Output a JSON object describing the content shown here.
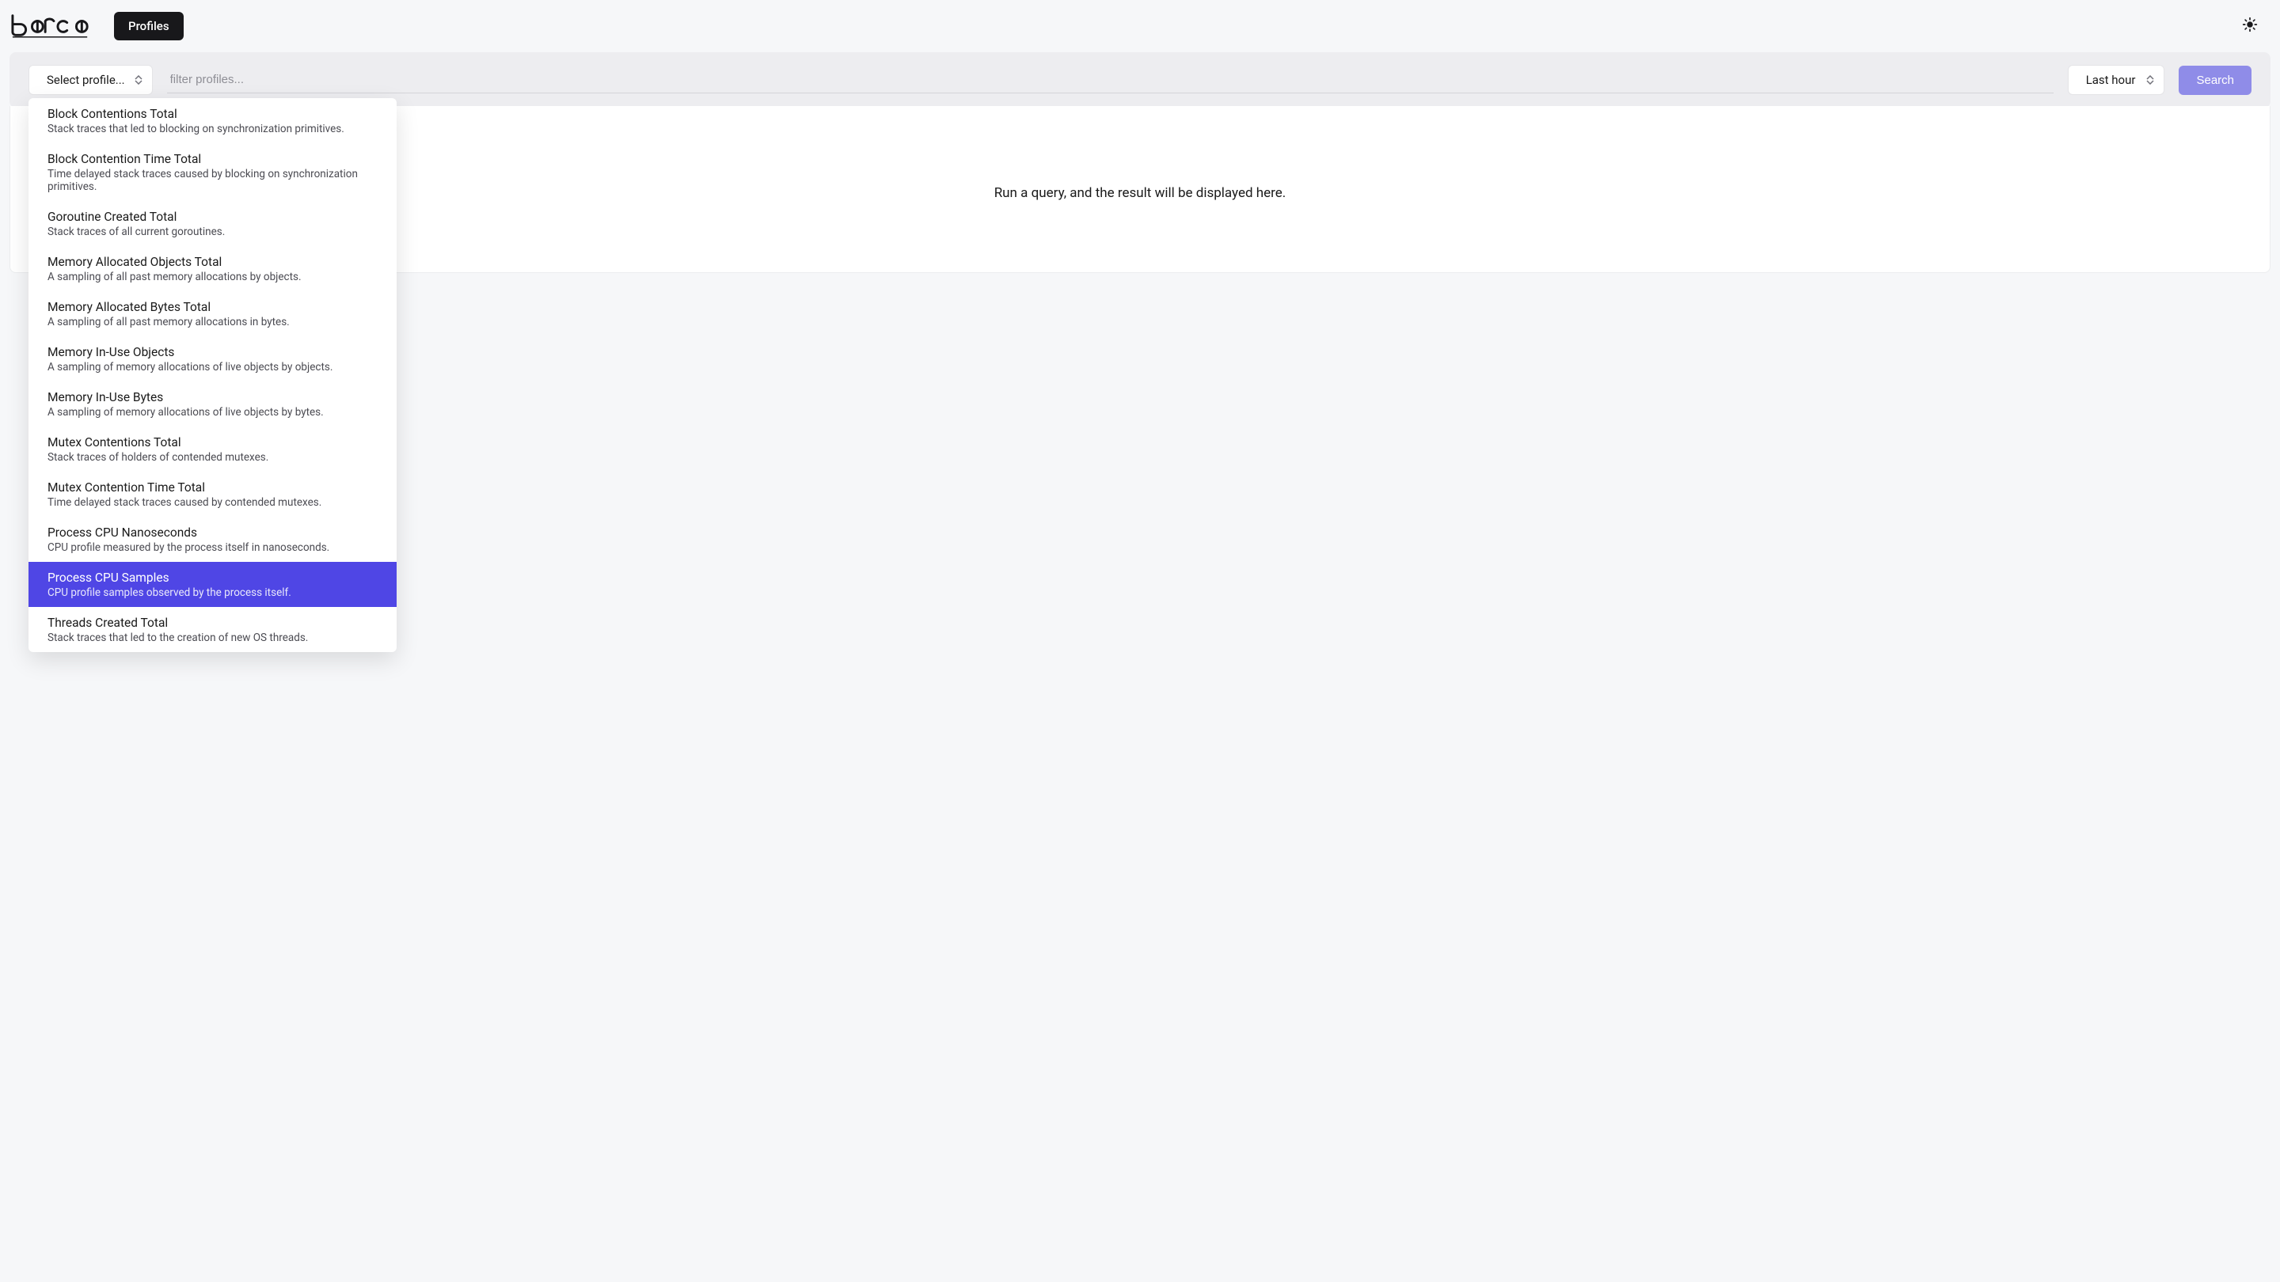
{
  "nav": {
    "profiles_label": "Profiles"
  },
  "query": {
    "select_profile_label": "Select profile...",
    "filter_placeholder": "filter profiles...",
    "time_range_label": "Last hour",
    "search_label": "Search"
  },
  "result": {
    "empty_message": "Run a query, and the result will be displayed here."
  },
  "dropdown": {
    "selected_index": 10,
    "items": [
      {
        "title": "Block Contentions Total",
        "desc": "Stack traces that led to blocking on synchronization primitives."
      },
      {
        "title": "Block Contention Time Total",
        "desc": "Time delayed stack traces caused by blocking on synchronization primitives."
      },
      {
        "title": "Goroutine Created Total",
        "desc": "Stack traces of all current goroutines."
      },
      {
        "title": "Memory Allocated Objects Total",
        "desc": "A sampling of all past memory allocations by objects."
      },
      {
        "title": "Memory Allocated Bytes Total",
        "desc": "A sampling of all past memory allocations in bytes."
      },
      {
        "title": "Memory In-Use Objects",
        "desc": "A sampling of memory allocations of live objects by objects."
      },
      {
        "title": "Memory In-Use Bytes",
        "desc": "A sampling of memory allocations of live objects by bytes."
      },
      {
        "title": "Mutex Contentions Total",
        "desc": "Stack traces of holders of contended mutexes."
      },
      {
        "title": "Mutex Contention Time Total",
        "desc": "Time delayed stack traces caused by contended mutexes."
      },
      {
        "title": "Process CPU Nanoseconds",
        "desc": "CPU profile measured by the process itself in nanoseconds."
      },
      {
        "title": "Process CPU Samples",
        "desc": "CPU profile samples observed by the process itself."
      },
      {
        "title": "Threads Created Total",
        "desc": "Stack traces that led to the creation of new OS threads."
      }
    ]
  }
}
